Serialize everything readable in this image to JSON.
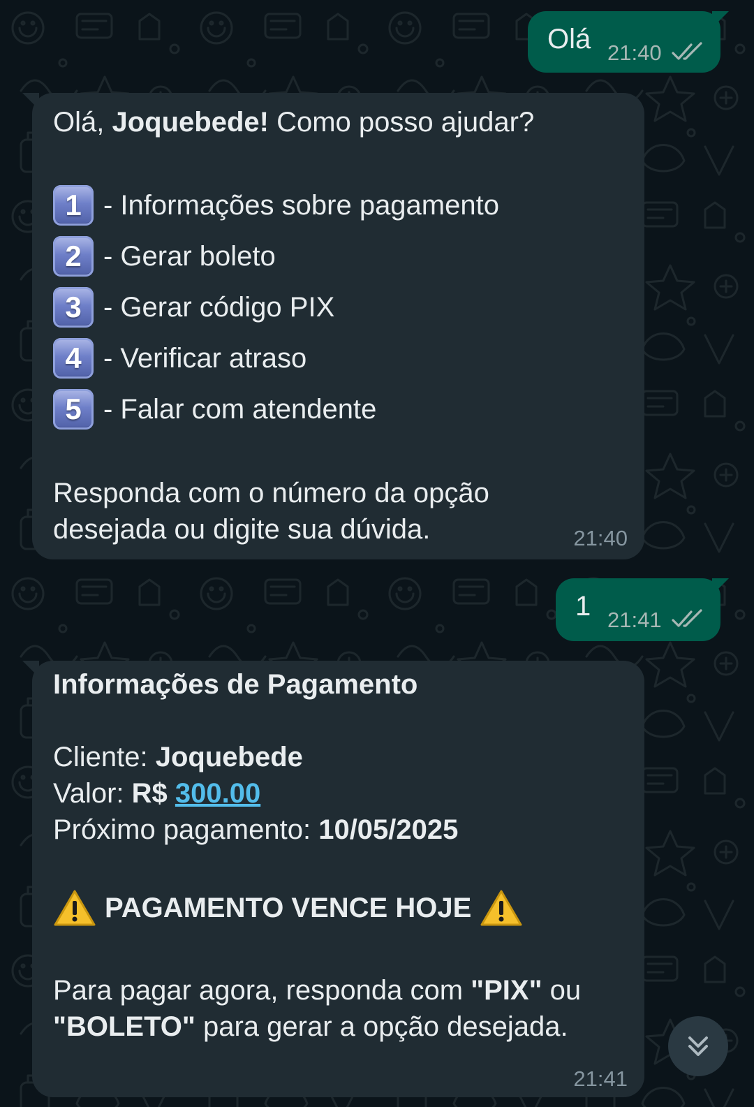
{
  "wallpaper": {
    "background_color": "#0b141a",
    "pattern_color": "#1d272c"
  },
  "colors": {
    "outgoing_bubble": "#005c4b",
    "incoming_bubble": "#202c33",
    "text": "#e9edef",
    "timestamp": "#8696a0",
    "link": "#53bdeb",
    "read_ticks": "#a7b8b5"
  },
  "messages": [
    {
      "direction": "outgoing",
      "text": "Olá",
      "time": "21:40",
      "status_icon": "double-check-icon"
    },
    {
      "direction": "incoming",
      "greeting_prefix": "Olá, ",
      "greeting_name": "Joquebede!",
      "greeting_suffix": " Como posso ajudar?",
      "options": [
        {
          "number": "1",
          "label": "- Informações sobre pagamento"
        },
        {
          "number": "2",
          "label": "- Gerar boleto"
        },
        {
          "number": "3",
          "label": "- Gerar código PIX"
        },
        {
          "number": "4",
          "label": "- Verificar atraso"
        },
        {
          "number": "5",
          "label": "- Falar com atendente"
        }
      ],
      "footer_line1": "Responda com o número da opção",
      "footer_line2": "desejada ou digite sua dúvida.",
      "time": "21:40"
    },
    {
      "direction": "outgoing",
      "text": "1",
      "time": "21:41",
      "status_icon": "double-check-icon"
    },
    {
      "direction": "incoming",
      "title": "Informações de Pagamento",
      "client_label": "Cliente: ",
      "client_name": "Joquebede",
      "value_label": "Valor: ",
      "currency": "R$ ",
      "amount": "300.00",
      "next_payment_label": "Próximo pagamento: ",
      "next_payment_date": "10/05/2025",
      "warning_icon": "warning-icon",
      "warning_text": "PAGAMENTO VENCE HOJE",
      "instructions_part1": "Para pagar agora, responda com ",
      "instructions_pix": "\"PIX\"",
      "instructions_part2": " ou",
      "instructions_boleto": "\"BOLETO\"",
      "instructions_part3": " para gerar a opção desejada.",
      "time": "21:41"
    }
  ],
  "scroll_button": {
    "icon": "double-chevron-down-icon"
  }
}
